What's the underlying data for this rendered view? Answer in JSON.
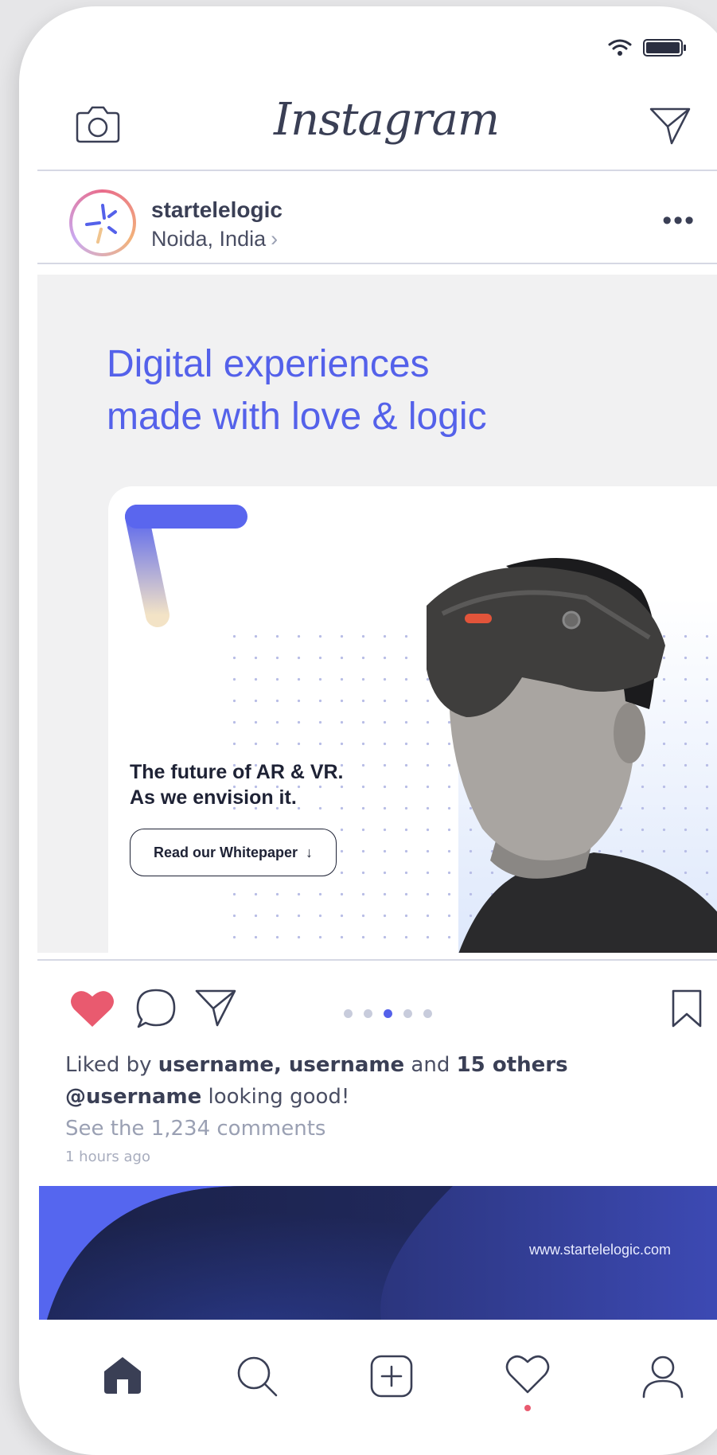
{
  "app": {
    "title": "Instagram"
  },
  "status_bar": {
    "wifi_icon": "wifi-icon",
    "battery_icon": "battery-icon"
  },
  "post": {
    "username": "startelelogic",
    "location": "Noida, India",
    "location_chevron": "›",
    "more": "•••",
    "headline_line1": "Digital experiences",
    "headline_line2": "made with love & logic",
    "card_line1": "The future of AR & VR.",
    "card_line2": "As we envision it.",
    "cta_label": "Read our Whitepaper",
    "cta_arrow": "↓",
    "carousel_total": 5,
    "carousel_active_index": 2,
    "liked": true
  },
  "meta": {
    "likes_prefix": "Liked by ",
    "likes_users": "username, username",
    "likes_and": " and ",
    "likes_others": "15 others",
    "caption_user": "@username",
    "caption_text": " looking good!",
    "comments_link": "See the 1,234 comments",
    "time": "1 hours ago"
  },
  "next_post": {
    "url": "www.startelelogic.com"
  },
  "colors": {
    "accent": "#5461ea",
    "like": "#e95a6f",
    "text_dark": "#3a3f55",
    "muted": "#9aa0b3"
  },
  "tabbar": {
    "items": [
      "home-icon",
      "search-icon",
      "add-post-icon",
      "activity-icon",
      "profile-icon"
    ],
    "active": "home-icon"
  }
}
